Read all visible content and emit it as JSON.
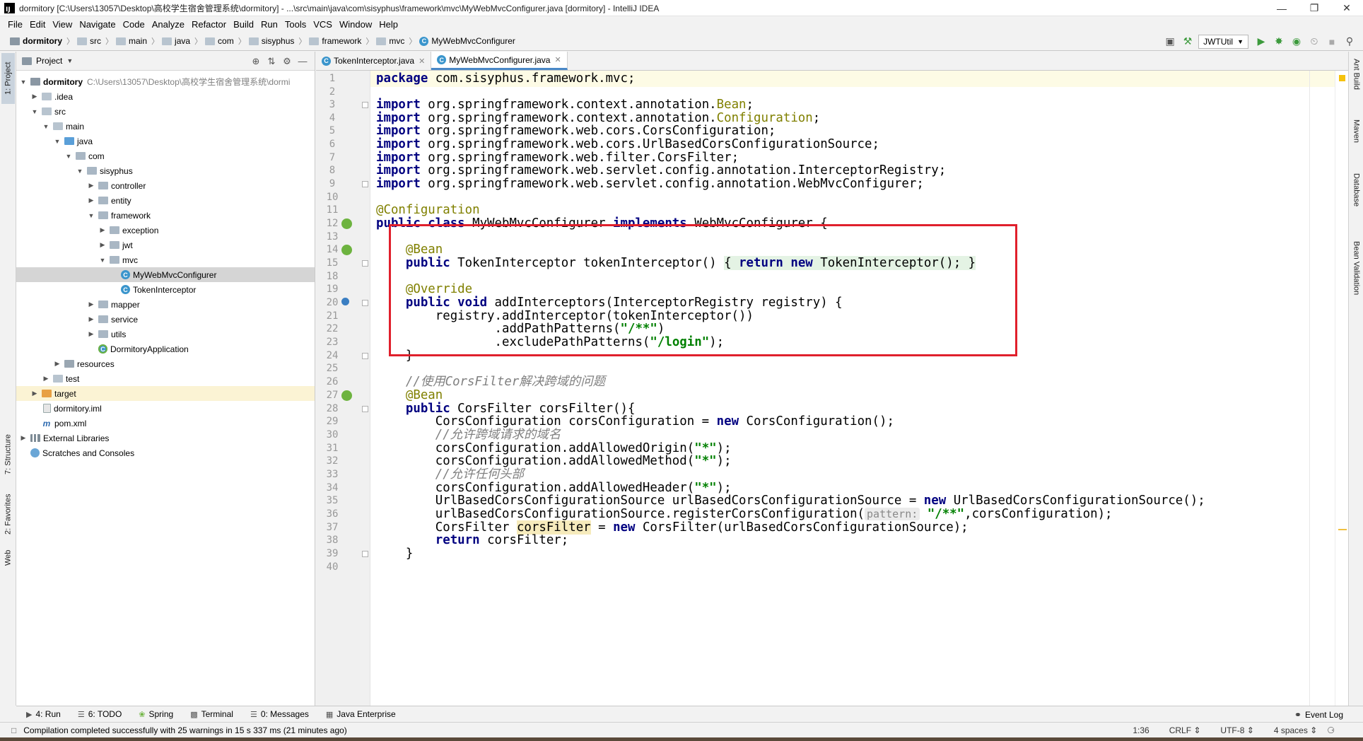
{
  "window": {
    "title": "dormitory [C:\\Users\\13057\\Desktop\\高校学生宿舍管理系统\\dormitory] - ...\\src\\main\\java\\com\\sisyphus\\framework\\mvc\\MyWebMvcConfigurer.java [dormitory] - IntelliJ IDEA",
    "logo": "IJ"
  },
  "menu": [
    "File",
    "Edit",
    "View",
    "Navigate",
    "Code",
    "Analyze",
    "Refactor",
    "Build",
    "Run",
    "Tools",
    "VCS",
    "Window",
    "Help"
  ],
  "breadcrumbs": [
    "dormitory",
    "src",
    "main",
    "java",
    "com",
    "sisyphus",
    "framework",
    "mvc",
    "MyWebMvcConfigurer"
  ],
  "toolbar": {
    "run_config": "JWTUtil"
  },
  "left_tabs": {
    "project": "1: Project",
    "structure": "7: Structure",
    "favorites": "2: Favorites",
    "web": "Web"
  },
  "right_tabs": {
    "ant": "Ant Build",
    "maven": "Maven",
    "database": "Database",
    "bean": "Bean Validation"
  },
  "project_panel": {
    "title": "Project",
    "tree": [
      {
        "label": "dormitory",
        "extra": "C:\\Users\\13057\\Desktop\\高校学生宿舍管理系统\\dormi"
      },
      {
        "label": ".idea"
      },
      {
        "label": "src"
      },
      {
        "label": "main"
      },
      {
        "label": "java"
      },
      {
        "label": "com"
      },
      {
        "label": "sisyphus"
      },
      {
        "label": "controller"
      },
      {
        "label": "entity"
      },
      {
        "label": "framework"
      },
      {
        "label": "exception"
      },
      {
        "label": "jwt"
      },
      {
        "label": "mvc"
      },
      {
        "label": "MyWebMvcConfigurer"
      },
      {
        "label": "TokenInterceptor"
      },
      {
        "label": "mapper"
      },
      {
        "label": "service"
      },
      {
        "label": "utils"
      },
      {
        "label": "DormitoryApplication"
      },
      {
        "label": "resources"
      },
      {
        "label": "test"
      },
      {
        "label": "target"
      },
      {
        "label": "dormitory.iml"
      },
      {
        "label": "pom.xml"
      },
      {
        "label": "External Libraries"
      },
      {
        "label": "Scratches and Consoles"
      }
    ]
  },
  "editor_tabs": [
    {
      "label": "TokenInterceptor.java"
    },
    {
      "label": "MyWebMvcConfigurer.java"
    }
  ],
  "line_numbers": [
    "1",
    "2",
    "3",
    "4",
    "5",
    "6",
    "7",
    "8",
    "9",
    "10",
    "11",
    "12",
    "13",
    "14",
    "15",
    "18",
    "19",
    "20",
    "21",
    "22",
    "23",
    "24",
    "25",
    "26",
    "27",
    "28",
    "29",
    "30",
    "31",
    "32",
    "33",
    "34",
    "35",
    "36",
    "37",
    "38",
    "39",
    "40"
  ],
  "code": {
    "l1_pkg": "package",
    "l1_rest": " com.sisyphus.framework.mvc;",
    "import": "import",
    "l3": " org.springframework.context.annotation.",
    "l3_t": "Bean",
    "l3_e": ";",
    "l4": " org.springframework.context.annotation.",
    "l4_t": "Configuration",
    "l4_e": ";",
    "l5": " org.springframework.web.cors.CorsConfiguration;",
    "l6": " org.springframework.web.cors.UrlBasedCorsConfigurationSource;",
    "l7": " org.springframework.web.filter.CorsFilter;",
    "l8": " org.springframework.web.servlet.config.annotation.InterceptorRegistry;",
    "l9": " org.springframework.web.servlet.config.annotation.WebMvcConfigurer;",
    "l11": "@Configuration",
    "l12_k1": "public class",
    "l12_a": " MyWebMvcConfigurer ",
    "l12_k2": "implements",
    "l12_b": " WebMvcConfigurer {",
    "l14": "    @Bean",
    "l15_k": "    public",
    "l15_a": " TokenInterceptor tokenInterceptor() ",
    "l15_o": "{ ",
    "l15_r": "return new",
    "l15_b": " TokenInterceptor(); ",
    "l15_c": "}",
    "l19": "    @Override",
    "l20_k": "    public void",
    "l20_a": " addInterceptors(InterceptorRegistry registry) {",
    "l21": "        registry.addInterceptor(tokenInterceptor())",
    "l22_a": "                .addPathPatterns(",
    "l22_s": "\"/**\"",
    "l22_b": ")",
    "l23_a": "                .excludePathPatterns(",
    "l23_s": "\"/login\"",
    "l23_b": ");",
    "l24": "    }",
    "l26": "    //使用CorsFilter解决跨域的问题",
    "l27": "    @Bean",
    "l28_k": "    public",
    "l28_a": " CorsFilter corsFilter(){",
    "l29_a": "        CorsConfiguration corsConfiguration = ",
    "l29_k": "new",
    "l29_b": " CorsConfiguration();",
    "l30": "        //允许跨域请求的域名",
    "l31_a": "        corsConfiguration.addAllowedOrigin(",
    "l31_s": "\"*\"",
    "l31_b": ");",
    "l32_a": "        corsConfiguration.addAllowedMethod(",
    "l32_s": "\"*\"",
    "l32_b": ");",
    "l33": "        //允许任何头部",
    "l34_a": "        corsConfiguration.addAllowedHeader(",
    "l34_s": "\"*\"",
    "l34_b": ");",
    "l35_a": "        UrlBasedCorsConfigurationSource urlBasedCorsConfigurationSource = ",
    "l35_k": "new",
    "l35_b": " UrlBasedCorsConfigurationSource();",
    "l36_a": "        urlBasedCorsConfigurationSource.registerCorsConfiguration(",
    "l36_h": "pattern:",
    "l36_s": " \"/**\"",
    "l36_b": ",corsConfiguration);",
    "l37_a": "        CorsFilter ",
    "l37_v": "corsFilter",
    "l37_m": " = ",
    "l37_k": "new",
    "l37_b": " CorsFilter(urlBasedCorsConfigurationSource);",
    "l38_k": "        return",
    "l38_a": " corsFilter;",
    "l39": "    }"
  },
  "bottom_tabs": [
    {
      "label": "4: Run"
    },
    {
      "label": "6: TODO"
    },
    {
      "label": "Spring"
    },
    {
      "label": "Terminal"
    },
    {
      "label": "0: Messages"
    },
    {
      "label": "Java Enterprise"
    }
  ],
  "event_log": "Event Log",
  "status": {
    "message": "Compilation completed successfully with 25 warnings in 15 s 337 ms (21 minutes ago)",
    "position": "1:36",
    "line_sep": "CRLF",
    "encoding": "UTF-8",
    "indent": "4 spaces"
  },
  "colors": {
    "accent": "#4a88c7",
    "highlight_box": "#e0202c",
    "keyword": "#000080",
    "string": "#008000",
    "annotation": "#808000"
  }
}
